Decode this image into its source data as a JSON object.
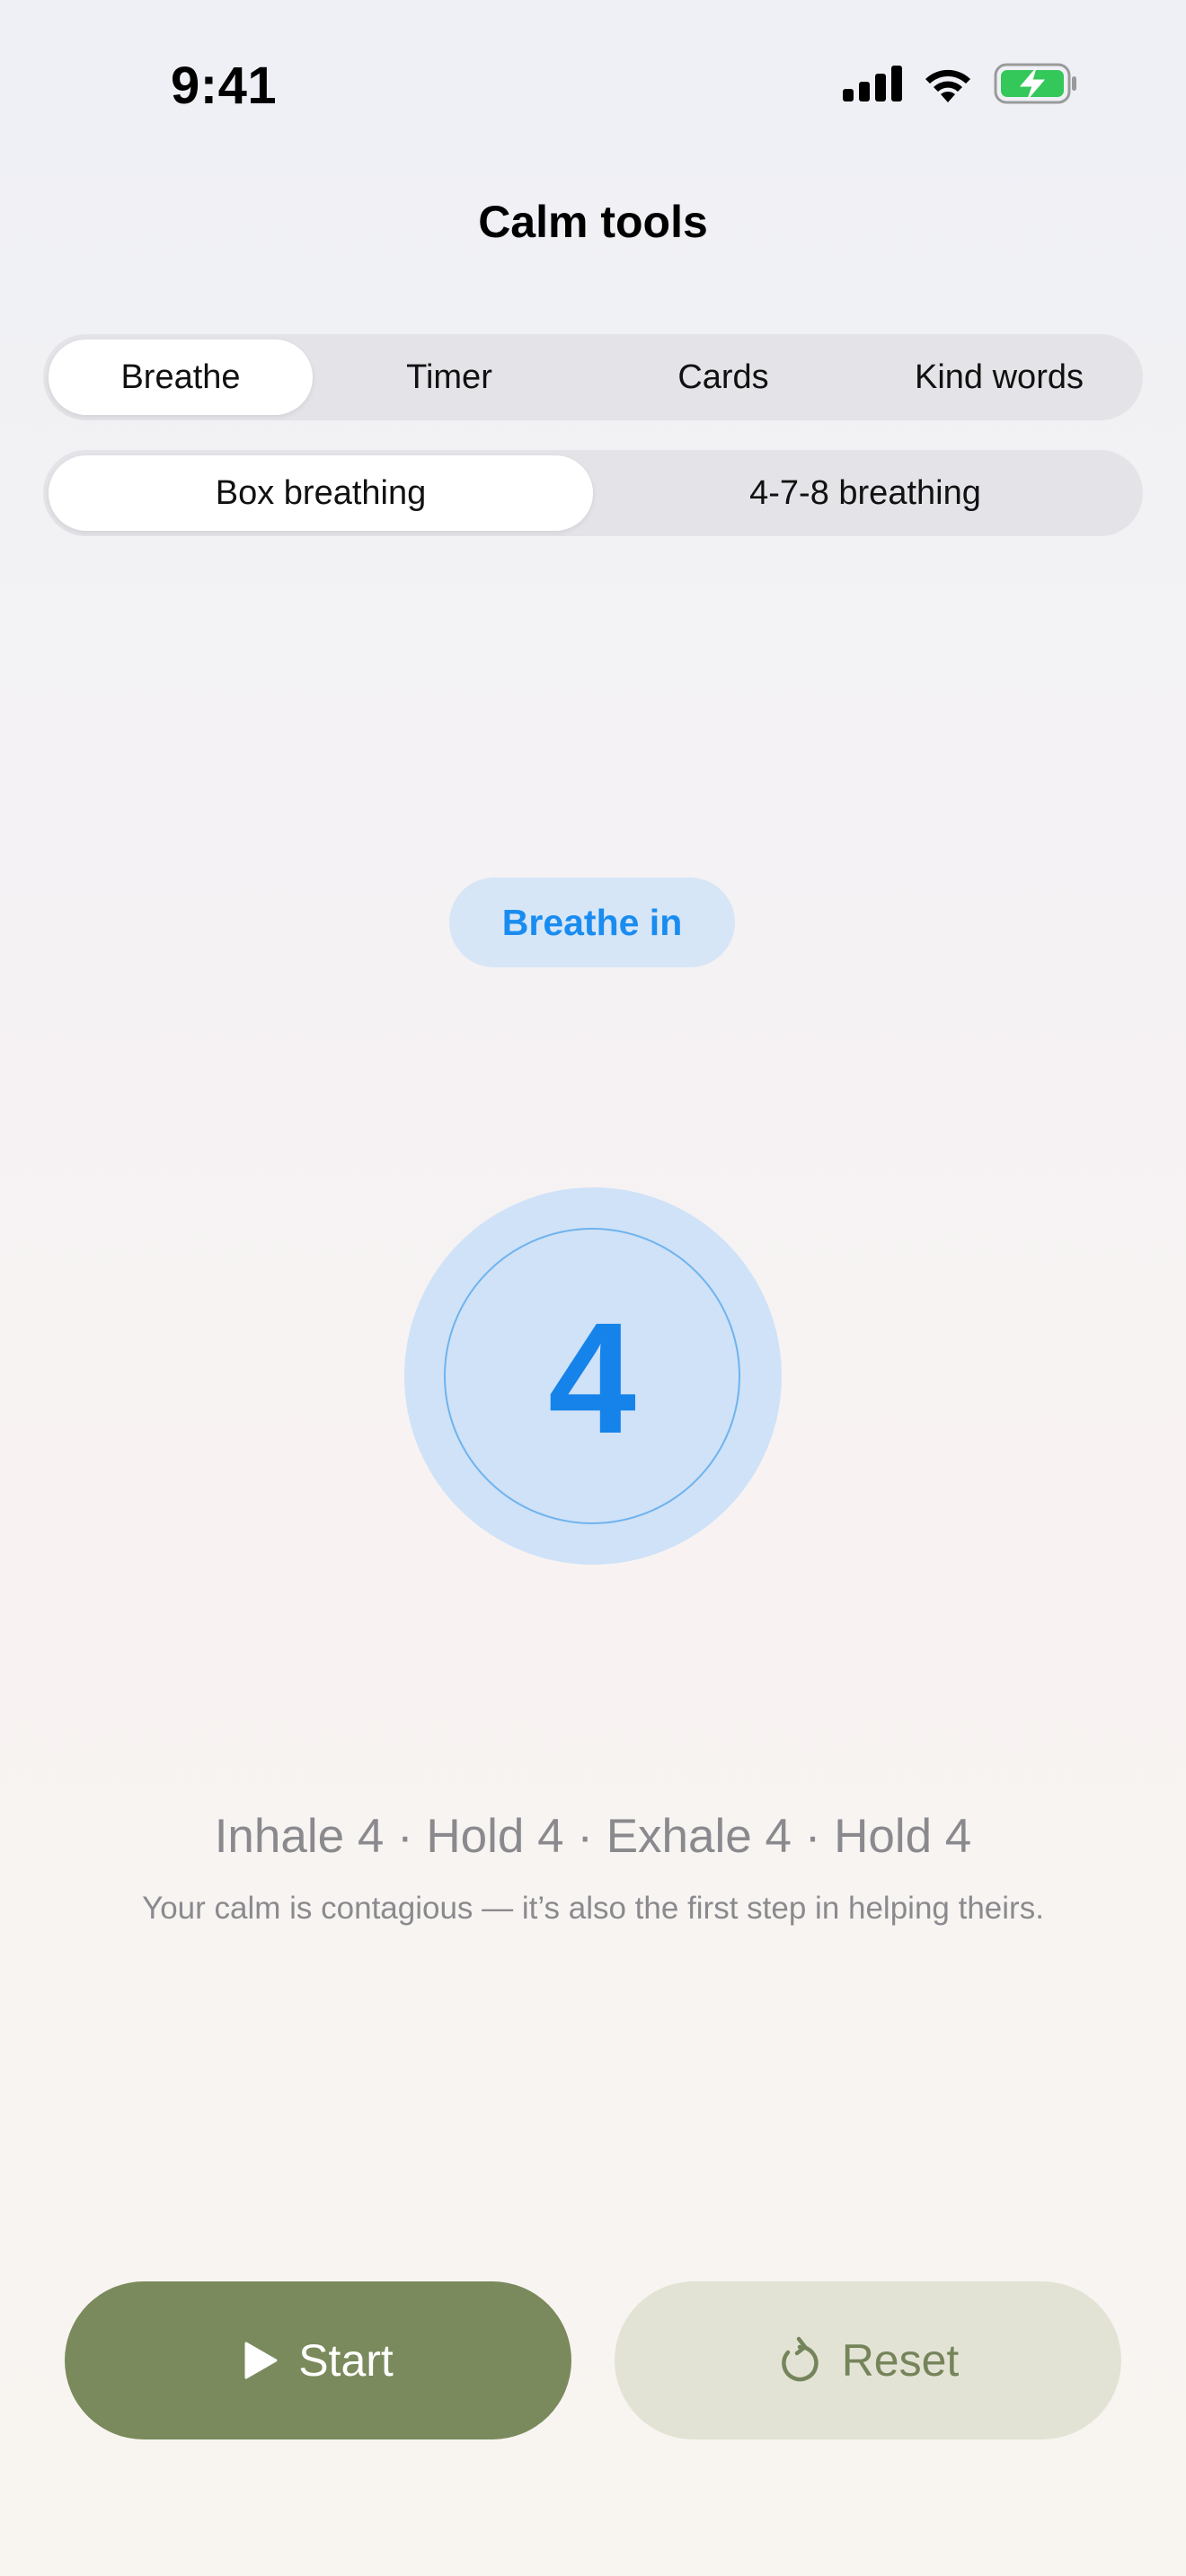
{
  "status_bar": {
    "time": "9:41",
    "icons": [
      "cellular-signal-icon",
      "wifi-icon",
      "battery-charging-icon"
    ],
    "battery_color": "#34c759"
  },
  "header": {
    "title": "Calm tools"
  },
  "tabs": [
    {
      "label": "Breathe",
      "active": true
    },
    {
      "label": "Timer",
      "active": false
    },
    {
      "label": "Cards",
      "active": false
    },
    {
      "label": "Kind words",
      "active": false
    }
  ],
  "modes": [
    {
      "label": "Box breathing",
      "active": true
    },
    {
      "label": "4-7-8 breathing",
      "active": false
    }
  ],
  "breath": {
    "phase": "Breathe in",
    "count": "4",
    "pattern": "Inhale 4 · Hold 4 · Exhale 4 · Hold 4",
    "note": "Your calm is contagious — it’s also the first step in helping theirs."
  },
  "buttons": {
    "start_label": "Start",
    "start_icon": "play-icon",
    "reset_label": "Reset",
    "reset_icon": "reset-icon"
  },
  "colors": {
    "accent": "#1583ea",
    "start_bg": "#7a8a5c",
    "reset_bg": "#e3e3d5"
  }
}
